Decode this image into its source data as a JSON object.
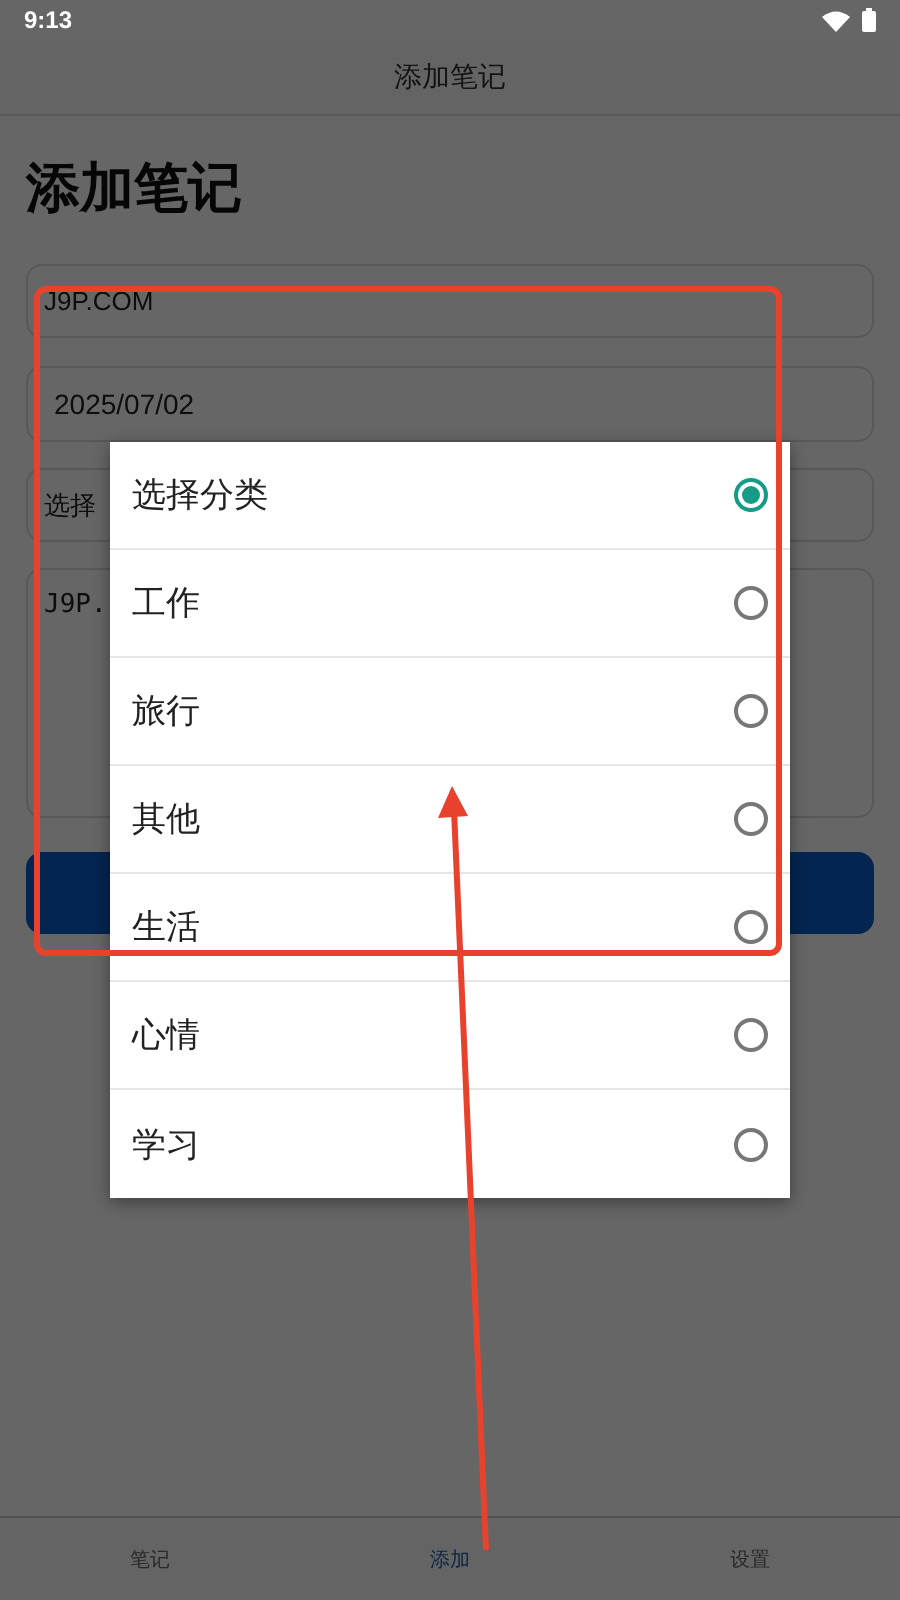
{
  "status_bar": {
    "time": "9:13"
  },
  "app_bar": {
    "title": "添加笔记"
  },
  "heading": "添加笔记",
  "form": [
    {
      "kind": "text",
      "value": "J9P.COM"
    },
    {
      "kind": "date",
      "value": "2025/07/02"
    },
    {
      "kind": "select",
      "value": "选择"
    },
    {
      "kind": "textarea",
      "value": "J9P."
    },
    {
      "kind": "button"
    }
  ],
  "dialog": {
    "options": [
      {
        "label": "选择分类",
        "selected": true
      },
      {
        "label": "工作",
        "selected": false
      },
      {
        "label": "旅行",
        "selected": false
      },
      {
        "label": "其他",
        "selected": false
      },
      {
        "label": "生活",
        "selected": false
      },
      {
        "label": "心情",
        "selected": false
      },
      {
        "label": "学习",
        "selected": false
      }
    ]
  },
  "bottom_nav": [
    {
      "label": "笔记",
      "selected": false
    },
    {
      "label": "添加",
      "selected": true
    },
    {
      "label": "设置",
      "selected": false
    }
  ]
}
